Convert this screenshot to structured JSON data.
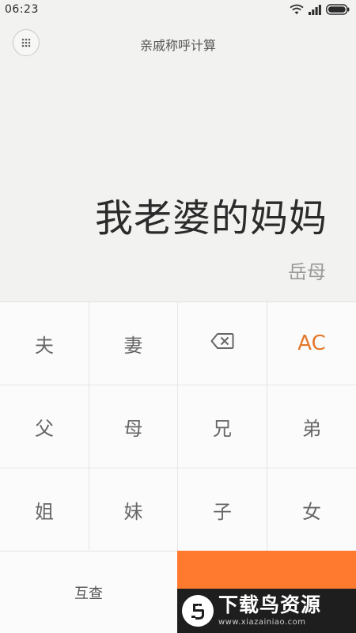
{
  "status_bar": {
    "time": "06:23"
  },
  "header": {
    "title": "亲戚称呼计算"
  },
  "display": {
    "expression": "我老婆的妈妈",
    "result": "岳母"
  },
  "keypad": {
    "rows": [
      [
        "夫",
        "妻",
        "",
        "AC"
      ],
      [
        "父",
        "母",
        "兄",
        "弟"
      ],
      [
        "姐",
        "妹",
        "子",
        "女"
      ]
    ],
    "swap_label": "互查"
  },
  "watermark": {
    "title": "下载鸟资源",
    "url": "www.xiazainiao.com"
  },
  "colors": {
    "accent": "#ff7a2e",
    "ac_text": "#e4782b",
    "display_bg": "#f2f2f0"
  },
  "icons": {
    "menu": "grid-dots-icon",
    "backspace": "backspace-icon",
    "wifi": "wifi-icon",
    "signal": "signal-icon",
    "battery": "battery-icon"
  }
}
